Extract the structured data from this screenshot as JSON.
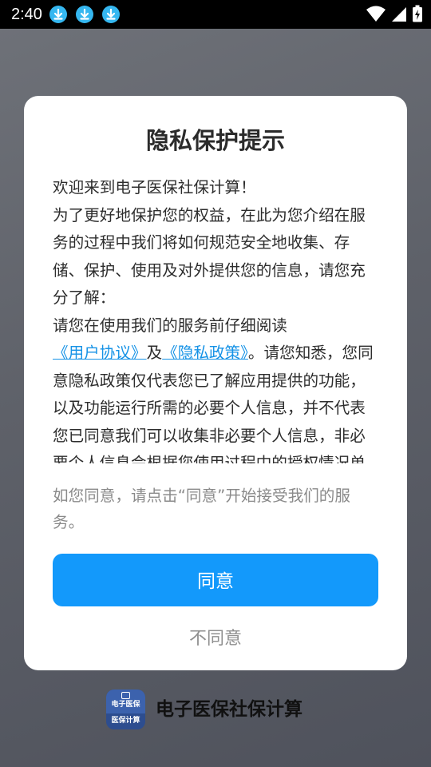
{
  "status_bar": {
    "time": "2:40",
    "download_notifications": 3,
    "icons": [
      "download-icon",
      "download-icon",
      "download-icon",
      "wifi-icon",
      "signal-icon",
      "battery-charging-icon"
    ]
  },
  "dialog": {
    "title": "隐私保护提示",
    "welcome": "欢迎来到电子医保社保计算！",
    "intro": "为了更好地保护您的权益，在此为您介绍在服务的过程中我们将如何规范安全地收集、存储、保护、使用及对外提供您的信息，请您充分了解：",
    "read_prefix": "请您在使用我们的服务前仔细阅读",
    "user_agreement_link": "《用户协议》",
    "and_text": "及",
    "privacy_policy_link": "《隐私政策》",
    "read_suffix": "。请您知悉，您同意隐私政策仅代表您已了解应用提供的功能，以及功能运行所需的必要个人信息，并不代表您已同意我们可以收集非必要个人信息，非必要个人信息会根据您使用过程中的授权情况单独征求",
    "note": "如您同意，请点击“同意”开始接受我们的服务。",
    "agree_label": "同意",
    "disagree_label": "不同意"
  },
  "app": {
    "icon_text_top": "电子医保",
    "icon_text_bottom": "医保计算",
    "name": "电子医保社保计算"
  },
  "colors": {
    "accent": "#1399fb",
    "link": "#1592e6",
    "download_badge": "#35b7f0"
  }
}
